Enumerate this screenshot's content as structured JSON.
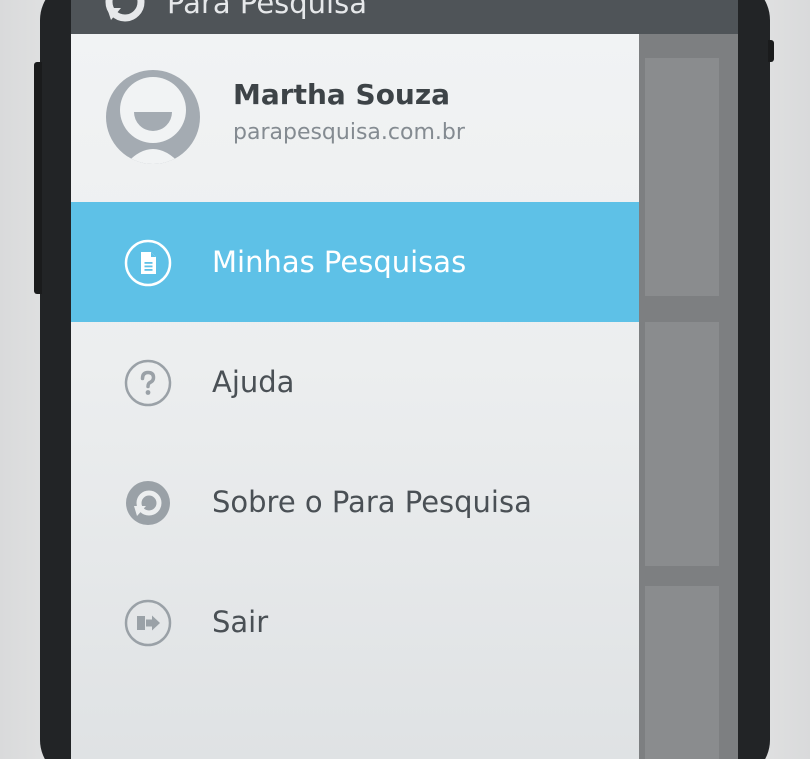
{
  "app_bar": {
    "title": "Para Pesquisa",
    "icon": "refresh-logo-icon"
  },
  "profile": {
    "name": "Martha Souza",
    "domain": "parapesquisa.com.br",
    "avatar_icon": "user-avatar-icon"
  },
  "menu": {
    "items": [
      {
        "label": "Minhas Pesquisas",
        "icon": "document-icon",
        "active": true
      },
      {
        "label": "Ajuda",
        "icon": "help-icon",
        "active": false
      },
      {
        "label": "Sobre o Para Pesquisa",
        "icon": "refresh-logo-icon",
        "active": false
      },
      {
        "label": "Sair",
        "icon": "logout-icon",
        "active": false
      }
    ]
  },
  "colors": {
    "accent": "#5ec1e7",
    "drawer_bg": "#eceeef",
    "text_primary": "#3d4347",
    "text_secondary": "#848b91",
    "icon_gray": "#9aa1a7",
    "app_bar": "#4f5458"
  }
}
